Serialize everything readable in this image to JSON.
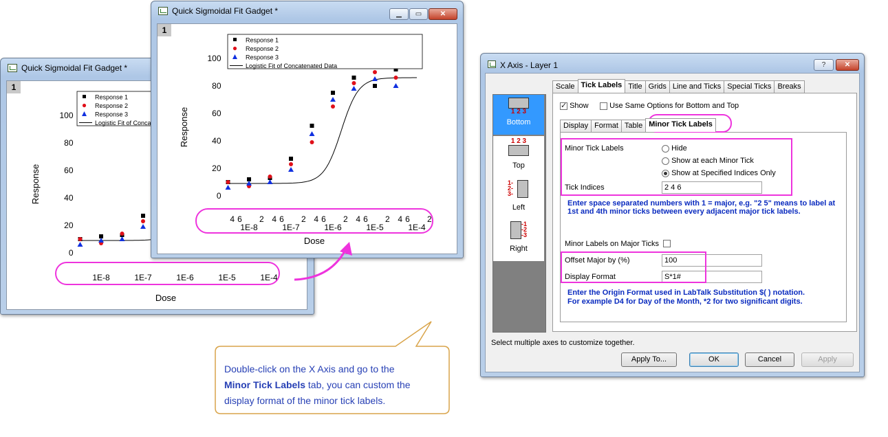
{
  "graph_back": {
    "title": "Quick Sigmoidal Fit Gadget *",
    "layer": "1",
    "legend": [
      "Response 1",
      "Response 2",
      "Response 3",
      "Logistic Fit of Concatenated Data"
    ],
    "ylabel": "Response",
    "xlabel": "Dose",
    "yticks": [
      "0",
      "20",
      "40",
      "60",
      "80",
      "100"
    ],
    "xmajor": [
      "1E-8",
      "1E-7",
      "1E-6",
      "1E-5",
      "1E-4"
    ]
  },
  "graph_front": {
    "title": "Quick Sigmoidal Fit Gadget *",
    "layer": "1",
    "legend": [
      "Response 1",
      "Response 2",
      "Response 3",
      "Logistic Fit of Concatenated Data"
    ],
    "ylabel": "Response",
    "xlabel": "Dose",
    "yticks": [
      "0",
      "20",
      "40",
      "60",
      "80",
      "100"
    ],
    "xmajor": [
      "1E-8",
      "1E-7",
      "1E-6",
      "1E-5",
      "1E-4"
    ],
    "xminor": [
      "4",
      "6",
      "2",
      "4",
      "6",
      "2",
      "4",
      "6",
      "2",
      "4",
      "6",
      "2",
      "4",
      "6",
      "2"
    ]
  },
  "chart_data": {
    "type": "scatter",
    "x": [
      "3.16E-8",
      "1E-7",
      "3.16E-7",
      "1E-6",
      "3.16E-6",
      "1E-5",
      "3.16E-5",
      "1E-4"
    ],
    "xscale": "log",
    "series": [
      {
        "name": "Response 1",
        "marker": "square",
        "color": "#000000",
        "values": [
          10,
          12,
          13,
          27,
          51,
          75,
          86,
          80,
          92
        ]
      },
      {
        "name": "Response 2",
        "marker": "circle",
        "color": "#e0101a",
        "values": [
          10,
          7,
          14,
          23,
          39,
          65,
          82,
          90,
          86
        ]
      },
      {
        "name": "Response 3",
        "marker": "triangle",
        "color": "#1030e0",
        "values": [
          6,
          9,
          10,
          19,
          45,
          70,
          78,
          85,
          80
        ]
      }
    ],
    "ylabel": "Response",
    "xlabel": "Dose",
    "ylim": [
      0,
      100
    ]
  },
  "dialog": {
    "title": "X Axis - Layer 1",
    "help": "?",
    "close": "X",
    "tabs": [
      "Scale",
      "Tick Labels",
      "Title",
      "Grids",
      "Line and Ticks",
      "Special Ticks",
      "Breaks"
    ],
    "positions": [
      "Bottom",
      "Top",
      "Left",
      "Right"
    ],
    "show_label": "Show",
    "same_options_label": "Use Same Options for Bottom and Top",
    "subtabs": [
      "Display",
      "Format",
      "Table",
      "Minor Tick Labels"
    ],
    "minor_tick_labels": "Minor Tick Labels",
    "radio_hide": "Hide",
    "radio_each": "Show at each Minor Tick",
    "radio_specified": "Show at Specified Indices Only",
    "tick_indices_label": "Tick Indices",
    "tick_indices_value": "2 4 6",
    "note1": "Enter space separated numbers with 1 = major, e.g. \"2 5\" means to label at 1st and 4th minor ticks between every adjacent major tick labels.",
    "minor_on_major_label": "Minor Labels on Major Ticks",
    "offset_label": "Offset Major by (%)",
    "offset_value": "100",
    "display_format_label": "Display Format",
    "display_format_value": "S*1#",
    "note2a": "Enter the Origin Format used in LabTalk Substitution $( ) notation.",
    "note2b": "For example D4 for Day of the Month, *2 for two significant digits.",
    "status": "Select multiple axes to customize together.",
    "btn_apply_to": "Apply To...",
    "btn_ok": "OK",
    "btn_cancel": "Cancel",
    "btn_apply": "Apply"
  },
  "callout": {
    "line1": "Double-click on the X Axis and go to the",
    "bold": "Minor Tick Labels",
    "line2rest": " tab, you can custom the",
    "line3": "display format of the minor tick labels."
  }
}
